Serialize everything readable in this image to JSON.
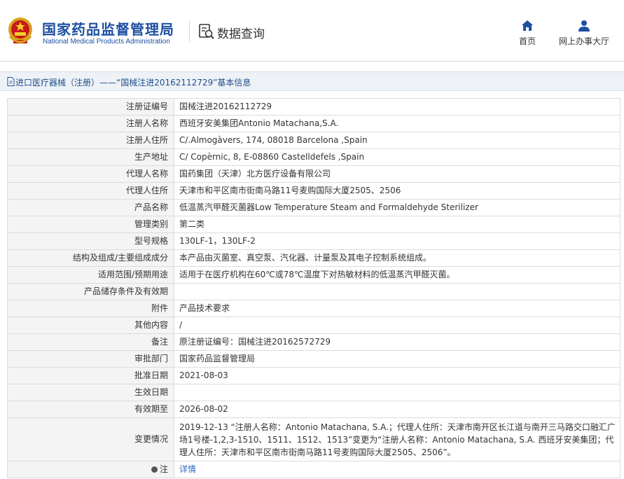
{
  "header": {
    "brand_cn": "国家药品监督管理局",
    "brand_en": "National Medical Products Administration",
    "query_label": "数据查询",
    "nav": [
      {
        "label": "首页",
        "icon": "home-icon"
      },
      {
        "label": "网上办事大厅",
        "icon": "user-icon"
      }
    ]
  },
  "breadcrumb": {
    "text": "进口医疗器械（注册）——“国械注进20162112729”基本信息"
  },
  "colors": {
    "brand_blue": "#1d4fa0",
    "link_blue": "#2a6bc5",
    "key_bg": "#f4f4f4",
    "crumb_bg": "#eef2f7"
  },
  "rows": [
    {
      "key": "注册证编号",
      "value": "国械注进20162112729"
    },
    {
      "key": "注册人名称",
      "value": "西班牙安美集团Antonio Matachana,S.A."
    },
    {
      "key": "注册人住所",
      "value": "C/.Almogàvers, 174, 08018 Barcelona ,Spain"
    },
    {
      "key": "生产地址",
      "value": "C/ Copèrnic, 8, E-08860 Castelldefels ,Spain"
    },
    {
      "key": "代理人名称",
      "value": "国药集团（天津）北方医疗设备有限公司"
    },
    {
      "key": "代理人住所",
      "value": "天津市和平区南市街南马路11号麦购国际大厦2505、2506"
    },
    {
      "key": "产品名称",
      "value": "低温蒸汽甲醛灭菌器Low Temperature Steam and Formaldehyde Sterilizer"
    },
    {
      "key": "管理类别",
      "value": "第二类"
    },
    {
      "key": "型号规格",
      "value": "130LF-1，130LF-2"
    },
    {
      "key": "结构及组成/主要组成成分",
      "value": "本产品由灭菌室、真空泵、汽化器、计量泵及其电子控制系统组成。"
    },
    {
      "key": "适用范围/预期用途",
      "value": "适用于在医疗机构在60℃或78℃温度下对热敏材料的低温蒸汽甲醛灭菌。"
    },
    {
      "key": "产品储存条件及有效期",
      "value": ""
    },
    {
      "key": "附件",
      "value": "产品技术要求"
    },
    {
      "key": "其他内容",
      "value": "/"
    },
    {
      "key": "备注",
      "value": "原注册证编号：国械注进20162572729"
    },
    {
      "key": "审批部门",
      "value": "国家药品监督管理局"
    },
    {
      "key": "批准日期",
      "value": "2021-08-03"
    },
    {
      "key": "生效日期",
      "value": ""
    },
    {
      "key": "有效期至",
      "value": "2026-08-02"
    },
    {
      "key": "变更情况",
      "value": "2019-12-13 “注册人名称：Antonio Matachana, S.A.；代理人住所：天津市南开区长江道与南开三马路交口融汇广场1号楼-1,2,3-1510、1511、1512、1513”变更为“注册人名称：Antonio Matachana, S.A. 西班牙安美集团；代理人住所：天津市和平区南市街南马路11号麦购国际大厦2505、2506”。"
    }
  ],
  "note": {
    "key": "注",
    "link": "详情"
  }
}
